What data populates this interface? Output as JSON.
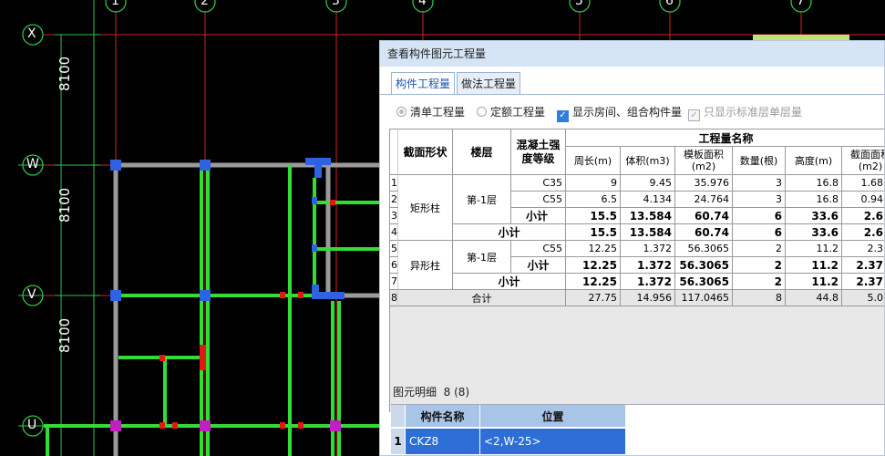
{
  "cad": {
    "axis_top": [
      "1",
      "2",
      "3",
      "4",
      "5",
      "6",
      "7"
    ],
    "axis_left": [
      "X",
      "W",
      "V",
      "U"
    ],
    "dimensions": [
      "8100",
      "8100",
      "8100"
    ]
  },
  "panel": {
    "title": "查看构件图元工程量",
    "tabs": [
      "构件工程量",
      "做法工程量"
    ],
    "options": {
      "list_qty": "清单工程量",
      "quota_qty": "定额工程量",
      "show_rooms": "显示房间、组合构件量",
      "std_floor_only": "只显示标准层单层量"
    },
    "table": {
      "headers": {
        "section_shape": "截面形状",
        "floor": "楼层",
        "concrete_grade": "混凝土强度等级",
        "qty_name": "工程量名称",
        "perimeter": "周长(m)",
        "volume": "体积(m3)",
        "formwork": "模板面积(m2)",
        "count": "数量(根)",
        "height": "高度(m)",
        "section_area": "截面面积(m2)"
      },
      "rows": [
        {
          "n": "1",
          "grade": "C35",
          "perimeter": "9",
          "volume": "9.45",
          "formwork": "35.976",
          "count": "3",
          "height": "16.8",
          "area": "1.68"
        },
        {
          "n": "2",
          "grade": "C55",
          "perimeter": "6.5",
          "volume": "4.134",
          "formwork": "24.764",
          "count": "3",
          "height": "16.8",
          "area": "0.94"
        },
        {
          "n": "3",
          "grade": "小计",
          "perimeter": "15.5",
          "volume": "13.584",
          "formwork": "60.74",
          "count": "6",
          "height": "33.6",
          "area": "2.6"
        },
        {
          "n": "4",
          "grade": "小计",
          "perimeter": "15.5",
          "volume": "13.584",
          "formwork": "60.74",
          "count": "6",
          "height": "33.6",
          "area": "2.6"
        },
        {
          "n": "5",
          "grade": "C55",
          "perimeter": "12.25",
          "volume": "1.372",
          "formwork": "56.3065",
          "count": "2",
          "height": "11.2",
          "area": "2.3"
        },
        {
          "n": "6",
          "grade": "小计",
          "perimeter": "12.25",
          "volume": "1.372",
          "formwork": "56.3065",
          "count": "2",
          "height": "11.2",
          "area": "2.37"
        },
        {
          "n": "7",
          "grade": "小计",
          "perimeter": "12.25",
          "volume": "1.372",
          "formwork": "56.3065",
          "count": "2",
          "height": "11.2",
          "area": "2.37"
        },
        {
          "n": "8",
          "grade": "合计",
          "perimeter": "27.75",
          "volume": "14.956",
          "formwork": "117.0465",
          "count": "8",
          "height": "44.8",
          "area": "5.0"
        }
      ],
      "groups": {
        "rect": "矩形柱",
        "special": "异形柱",
        "floor1": "第-1层",
        "floor1b": "第-1层"
      }
    },
    "detail": {
      "title": "图元明细",
      "count": "8 (8)",
      "col_name": "构件名称",
      "col_pos": "位置",
      "row_num": "1",
      "row_name": "CKZ8",
      "row_pos": "<2,W-25>"
    }
  }
}
